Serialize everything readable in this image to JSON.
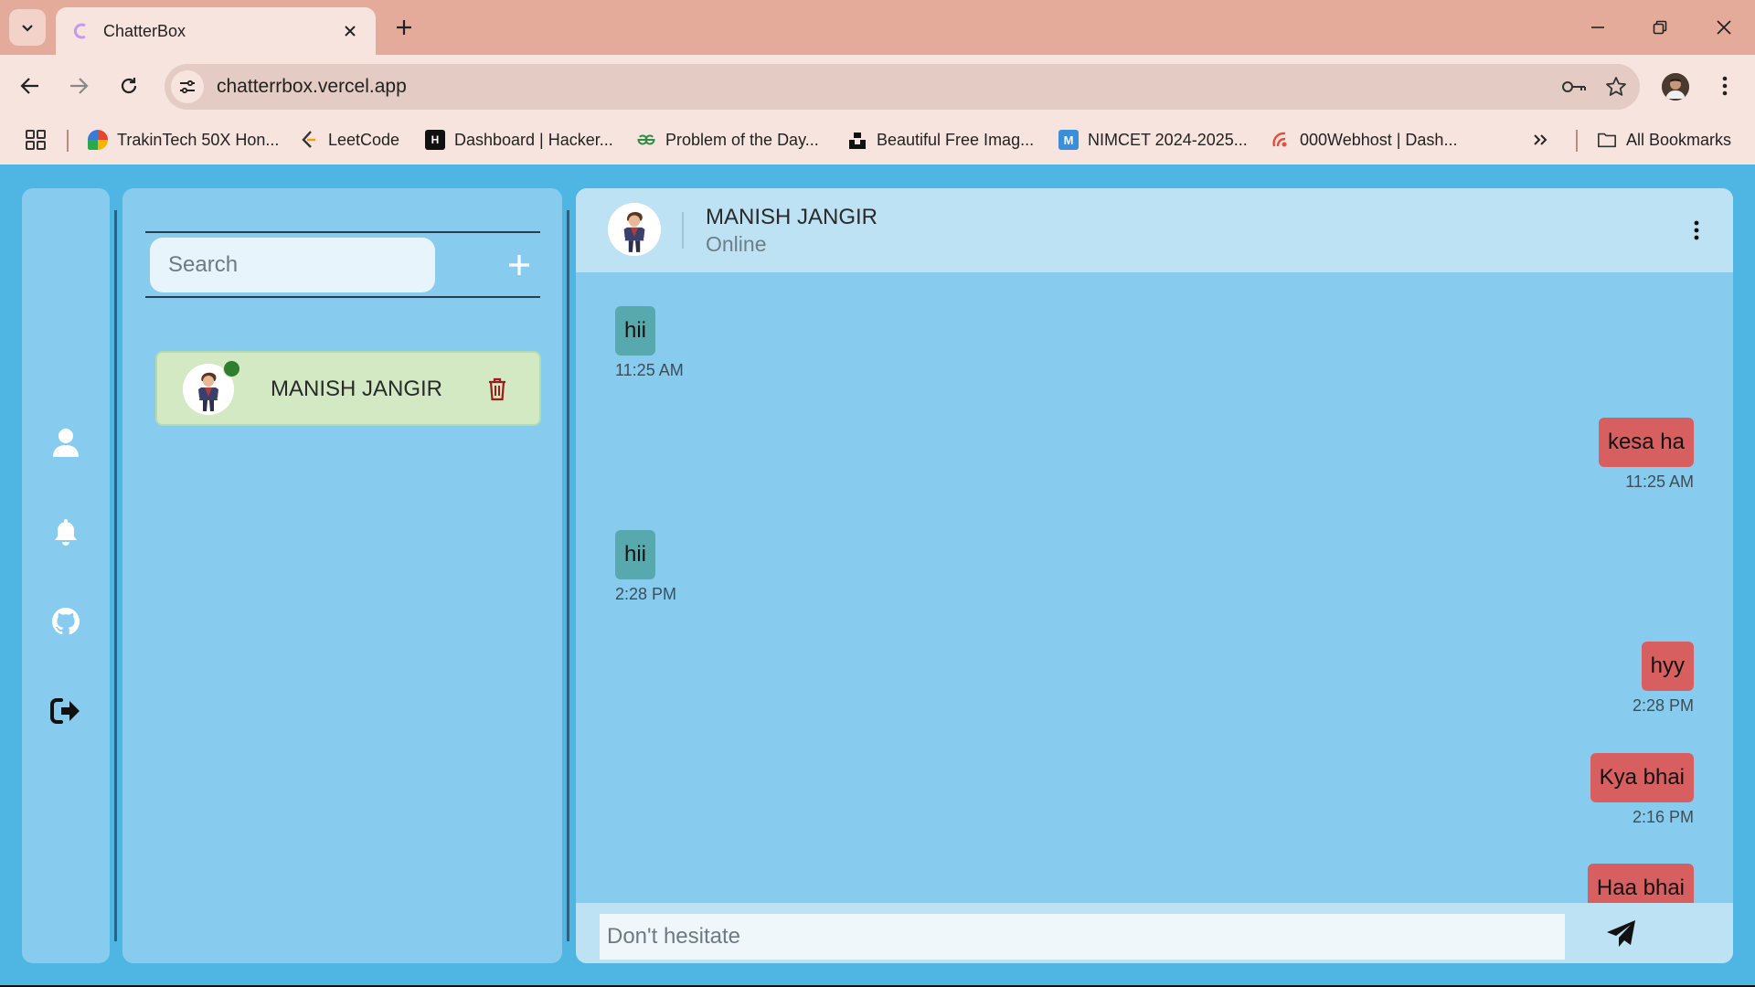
{
  "browser": {
    "tab_title": "ChatterBox",
    "url": "chatterrbox.vercel.app"
  },
  "bookmarks": {
    "items": [
      {
        "label": "TrakinTech 50X Hon...",
        "icon": "trakintech-icon"
      },
      {
        "label": "LeetCode",
        "icon": "leetcode-icon"
      },
      {
        "label": "Dashboard | Hacker...",
        "icon": "hackerrank-icon"
      },
      {
        "label": "Problem of the Day...",
        "icon": "geeksforgeeks-icon"
      },
      {
        "label": "Beautiful Free Imag...",
        "icon": "unsplash-icon"
      },
      {
        "label": "NIMCET 2024-2025...",
        "icon": "nimcet-icon"
      },
      {
        "label": "000Webhost | Dash...",
        "icon": "webhost-icon"
      }
    ],
    "all_bookmarks": "All Bookmarks"
  },
  "sidebar": {
    "icons": [
      "user-icon",
      "bell-icon",
      "github-icon",
      "logout-icon"
    ]
  },
  "contacts": {
    "search_placeholder": "Search",
    "items": [
      {
        "name": "MANISH JANGIR",
        "online": true
      }
    ]
  },
  "chat": {
    "contact_name": "MANISH JANGIR",
    "status": "Online",
    "messages": [
      {
        "direction": "in",
        "text": "hii",
        "time": "11:25 AM"
      },
      {
        "direction": "out",
        "text": "kesa ha",
        "time": "11:25 AM"
      },
      {
        "direction": "in",
        "text": "hii",
        "time": "2:28 PM"
      },
      {
        "direction": "out",
        "text": "hyy",
        "time": "2:28 PM"
      },
      {
        "direction": "out",
        "text": "Kya bhai",
        "time": "2:16 PM"
      },
      {
        "direction": "out",
        "text": "Haa bhai",
        "time": ""
      }
    ],
    "input_placeholder": "Don't hesitate"
  },
  "colors": {
    "page_bg": "#4fb6e3",
    "panel_bg": "#87cbee",
    "incoming_bubble": "#57a9ad",
    "outgoing_bubble": "#d85f5f",
    "contact_card": "#d2e9c4",
    "online_dot": "#2d7f2d",
    "delete_icon": "#9b1c1c"
  }
}
